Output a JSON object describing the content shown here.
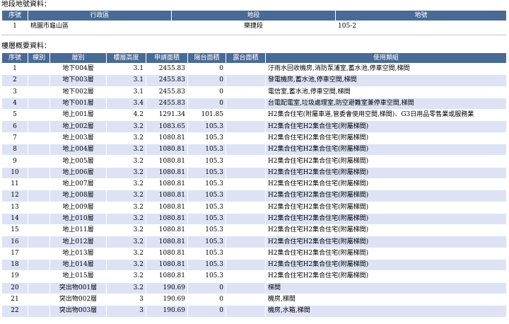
{
  "land_section": {
    "caption": "地段地號資料：",
    "headers": [
      "序號",
      "行政區",
      "地段",
      "地號"
    ],
    "rows": [
      [
        "1",
        "桃園市龜山區",
        "樂捷段",
        "105-2"
      ]
    ]
  },
  "floor_section": {
    "caption": "樓層概要資料：",
    "headers": [
      "序號",
      "棟別",
      "層別",
      "樓層高度",
      "申請面積",
      "陽台面積",
      "露台面積",
      "使用類組"
    ],
    "rows": [
      [
        "1",
        "",
        "地下004層",
        "3.1",
        "2455.83",
        "0",
        "",
        "汙雨水回收機房,消防泵浦室,蓄水池,停車空間,梯間"
      ],
      [
        "2",
        "",
        "地下003層",
        "3.1",
        "2455.83",
        "0",
        "",
        "發電機房,蓄水池,停車空間,梯間"
      ],
      [
        "3",
        "",
        "地下002層",
        "3.1",
        "2455.83",
        "0",
        "",
        "電信室,蓄水池,停車空間,梯間"
      ],
      [
        "4",
        "",
        "地下001層",
        "3.4",
        "2455.83",
        "0",
        "",
        "台電配電室,垃圾處理室,防空避難室兼停車空間,梯間"
      ],
      [
        "5",
        "",
        "地上001層",
        "4.2",
        "1291.34",
        "101.85",
        "",
        "H2集合住宅(附屬車道,管委會使用空間,梯間)、G3日用品零售業或服務業"
      ],
      [
        "6",
        "",
        "地上002層",
        "3.2",
        "1083.65",
        "105.3",
        "",
        "H2集合住宅H2集合住宅(附屬梯間)"
      ],
      [
        "7",
        "",
        "地上003層",
        "3.2",
        "1080.81",
        "105.3",
        "",
        "H2集合住宅H2集合住宅(附屬梯間)"
      ],
      [
        "8",
        "",
        "地上004層",
        "3.2",
        "1080.81",
        "105.3",
        "",
        "H2集合住宅H2集合住宅(附屬梯間)"
      ],
      [
        "9",
        "",
        "地上005層",
        "3.2",
        "1080.81",
        "105.3",
        "",
        "H2集合住宅H2集合住宅(附屬梯間)"
      ],
      [
        "10",
        "",
        "地上006層",
        "3.2",
        "1080.81",
        "105.3",
        "",
        "H2集合住宅H2集合住宅(附屬梯間)"
      ],
      [
        "11",
        "",
        "地上007層",
        "3.2",
        "1080.81",
        "105.3",
        "",
        "H2集合住宅H2集合住宅(附屬梯間)"
      ],
      [
        "12",
        "",
        "地上008層",
        "3.2",
        "1080.81",
        "105.3",
        "",
        "H2集合住宅H2集合住宅(附屬梯間)"
      ],
      [
        "13",
        "",
        "地上009層",
        "3.2",
        "1080.81",
        "105.3",
        "",
        "H2集合住宅H2集合住宅(附屬梯間)"
      ],
      [
        "14",
        "",
        "地上010層",
        "3.2",
        "1080.81",
        "105.3",
        "",
        "H2集合住宅H2集合住宅(附屬梯間)"
      ],
      [
        "15",
        "",
        "地上011層",
        "3.2",
        "1080.81",
        "105.3",
        "",
        "H2集合住宅H2集合住宅(附屬梯間)"
      ],
      [
        "16",
        "",
        "地上012層",
        "3.2",
        "1080.81",
        "105.3",
        "",
        "H2集合住宅H2集合住宅(附屬梯間)"
      ],
      [
        "17",
        "",
        "地上013層",
        "3.2",
        "1080.81",
        "105.3",
        "",
        "H2集合住宅H2集合住宅(附屬梯間)"
      ],
      [
        "18",
        "",
        "地上014層",
        "3.2",
        "1080.81",
        "105.3",
        "",
        "H2集合住宅H2集合住宅(附屬梯間)"
      ],
      [
        "19",
        "",
        "地上015層",
        "3.2",
        "1080.81",
        "105.3",
        "",
        "H2集合住宅H2集合住宅(附屬梯間)"
      ],
      [
        "20",
        "",
        "突出物001層",
        "3.2",
        "190.69",
        "0",
        "",
        "梯間"
      ],
      [
        "21",
        "",
        "突出物002層",
        "3",
        "190.69",
        "0",
        "",
        "機房,梯間"
      ],
      [
        "22",
        "",
        "突出物003層",
        "3",
        "190.69",
        "0",
        "",
        "機房,水箱,梯間"
      ]
    ]
  },
  "colors": {
    "header_bg": "#4a6a96",
    "row_alt_bg": "#dde3f5"
  }
}
